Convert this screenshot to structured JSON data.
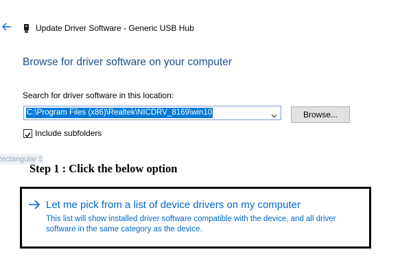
{
  "header": {
    "back_icon": "back-arrow-icon",
    "device_icon": "usb-device-icon",
    "title": "Update Driver Software - Generic USB Hub"
  },
  "main": {
    "heading": "Browse for driver software on your computer",
    "field_label": "Search for driver software in this location:",
    "path_value": "C:\\Program Files (x86)\\Realtek\\NICDRV_8169\\win10",
    "browse_label": "Browse...",
    "include_subfolders_label": "Include subfolders",
    "include_subfolders_checked": true,
    "pick_option": {
      "title": "Let me pick from a list of device drivers on my computer",
      "description": "This list will show installed driver software compatible with the device, and all driver software in the same category as the device."
    }
  },
  "overlays": {
    "snip_text": "Rectangular Snip",
    "annotation": "Step 1 : Click the below option"
  },
  "colors": {
    "accent": "#0066cc",
    "heading": "#1f4f8b",
    "selection": "#0078d7"
  }
}
